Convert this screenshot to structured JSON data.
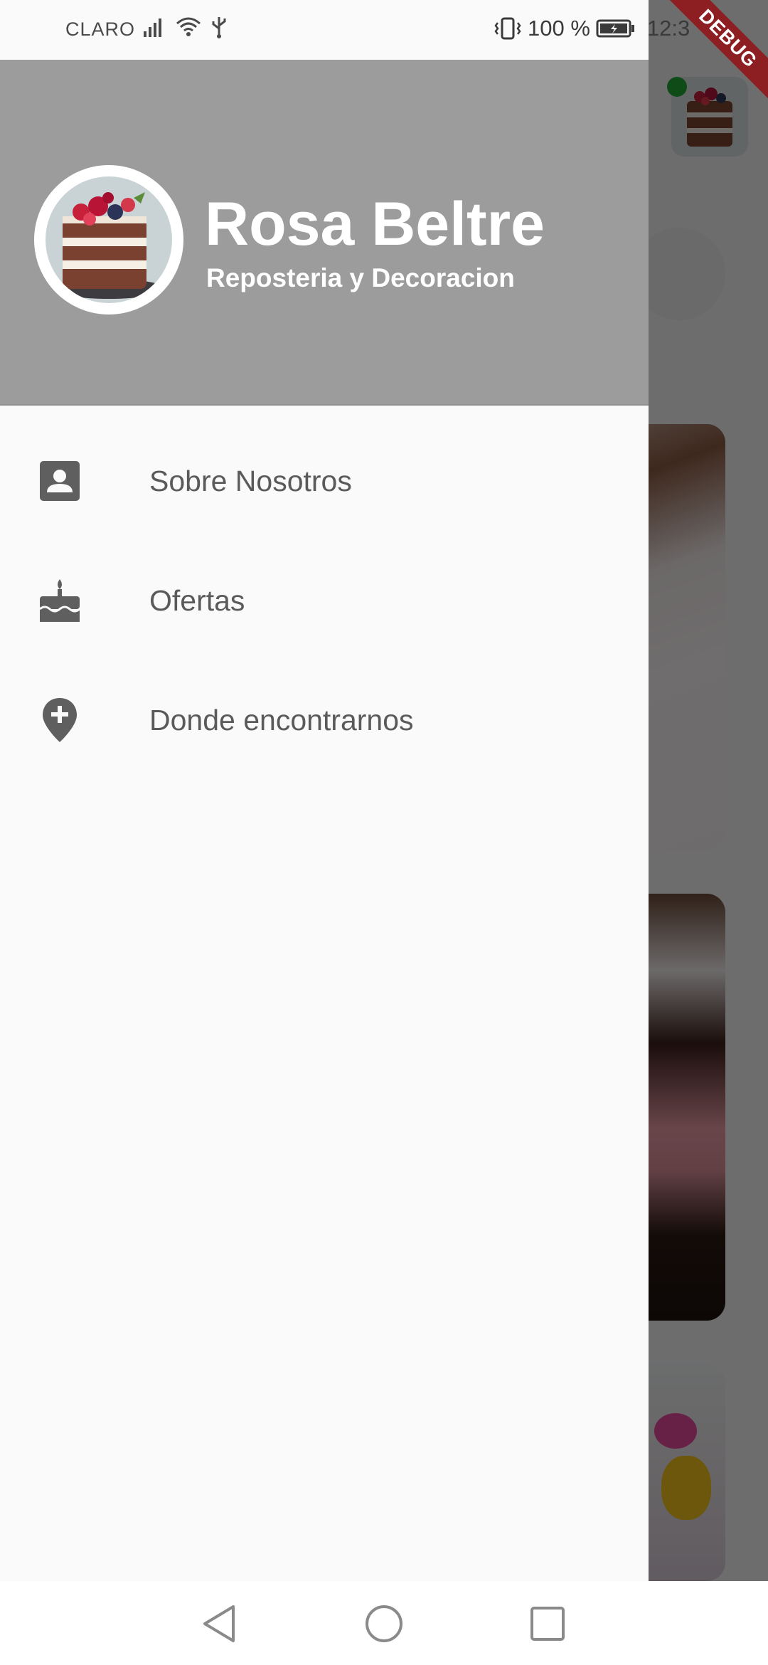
{
  "status_bar": {
    "carrier": "CLARO",
    "battery_percent": "100 %",
    "time": "12:3"
  },
  "debug_banner": "DEBUG",
  "drawer": {
    "header": {
      "name": "Rosa Beltre",
      "subtitle": "Reposteria y Decoracion"
    },
    "items": [
      {
        "label": "Sobre Nosotros",
        "icon": "contact-card-icon"
      },
      {
        "label": "Ofertas",
        "icon": "cake-icon"
      },
      {
        "label": "Donde encontrarnos",
        "icon": "add-location-icon"
      }
    ]
  },
  "nav_bar": {
    "buttons": [
      "back-icon",
      "home-icon",
      "recents-icon"
    ]
  },
  "colors": {
    "header_bg": "#9c9c9c",
    "drawer_bg": "#fafafa",
    "icon": "#5f5f5f",
    "item_text": "#5a5a5a",
    "online_indicator": "#22a634",
    "debug_ribbon": "#8d1f22"
  }
}
